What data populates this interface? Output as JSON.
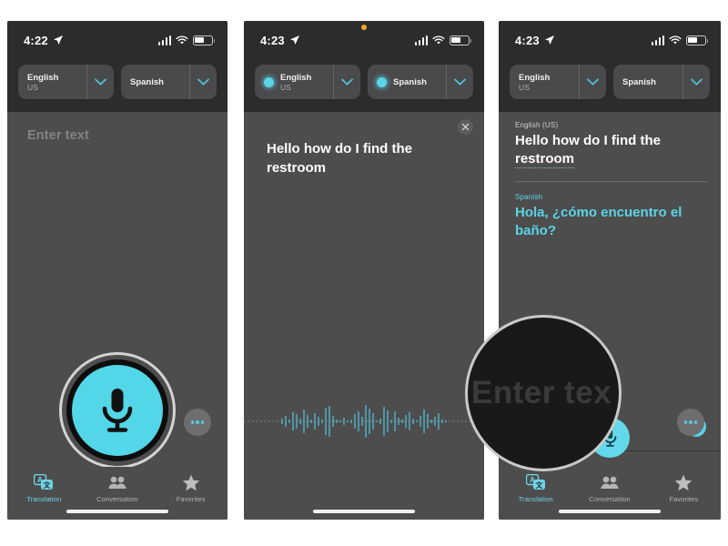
{
  "panels": [
    {
      "id": "panel-1",
      "status": {
        "time": "4:22",
        "location_icon": "location-arrow-icon",
        "signal": "cellular-signal-icon",
        "wifi": "wifi-icon",
        "battery": "battery-icon",
        "recording_dot": false
      },
      "source_lang": {
        "name": "English",
        "region": "US",
        "has_dot": false
      },
      "target_lang": {
        "name": "Spanish",
        "region": "",
        "has_dot": false
      },
      "placeholder": "Enter text",
      "mic_state": "idle-large",
      "more_label": "more-options",
      "tabs": [
        {
          "label": "Translation",
          "icon": "translation-bubbles-icon",
          "active": true
        },
        {
          "label": "Conversation",
          "icon": "people-icon",
          "active": false
        },
        {
          "label": "Favorites",
          "icon": "star-icon",
          "active": false
        }
      ]
    },
    {
      "id": "panel-2",
      "status": {
        "time": "4:23",
        "location_icon": "location-arrow-icon",
        "signal": "cellular-signal-icon",
        "wifi": "wifi-icon",
        "battery": "battery-icon",
        "recording_dot": true
      },
      "source_lang": {
        "name": "English",
        "region": "US",
        "has_dot": true
      },
      "target_lang": {
        "name": "Spanish",
        "region": "",
        "has_dot": true
      },
      "spoken_text": "Hello how do I find the restroom",
      "close_label": "close",
      "waveform": "audio-waveform",
      "mic_state": "listening",
      "tabs": []
    },
    {
      "id": "panel-3",
      "status": {
        "time": "4:23",
        "location_icon": "location-arrow-icon",
        "signal": "cellular-signal-icon",
        "wifi": "wifi-icon",
        "battery": "battery-icon",
        "recording_dot": false
      },
      "source_lang": {
        "name": "English",
        "region": "US",
        "has_dot": false
      },
      "target_lang": {
        "name": "Spanish",
        "region": "",
        "has_dot": false
      },
      "result": {
        "source_label": "English (US)",
        "source_text_plain": "Hello how do I find the ",
        "source_text_underlined": "restroom",
        "target_label": "Spanish",
        "target_text": "Hola, ¿cómo encuentro el baño?",
        "play_label": "play-translation"
      },
      "placeholder": "Enter tex",
      "magnifier_text": "Enter tex",
      "mic_state": "idle-small",
      "more_label": "more-options",
      "tabs": [
        {
          "label": "Translation",
          "icon": "translation-bubbles-icon",
          "active": true
        },
        {
          "label": "Conversation",
          "icon": "people-icon",
          "active": false
        },
        {
          "label": "Favorites",
          "icon": "star-icon",
          "active": false
        }
      ]
    }
  ],
  "colors": {
    "accent": "#5ad4e6",
    "panel_bg": "#4d4d4d",
    "chrome_bg": "#2c2c2e",
    "pill_bg": "#4a4a4c"
  }
}
